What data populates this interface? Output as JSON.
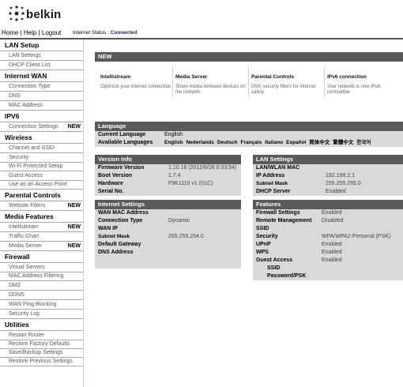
{
  "header": {
    "brand": "belkin",
    "nav": {
      "home": "Home",
      "sep1": "|",
      "help": "Help",
      "sep2": "|",
      "logout": "Logout"
    },
    "internet_status_label": "Internet Status :",
    "internet_status_value": "Connected"
  },
  "sidebar": {
    "sections": [
      {
        "title": "LAN Setup",
        "items": [
          {
            "label": "LAN Settings"
          },
          {
            "label": "DHCP Client List"
          }
        ]
      },
      {
        "title": "Internet WAN",
        "items": [
          {
            "label": "Connection Type"
          },
          {
            "label": "DNS"
          },
          {
            "label": "MAC Address"
          }
        ]
      },
      {
        "title": "IPV6",
        "items": [
          {
            "label": "Connection Settings",
            "badge": "NEW"
          }
        ]
      },
      {
        "title": "Wireless",
        "items": [
          {
            "label": "Channel and SSID"
          },
          {
            "label": "Security"
          },
          {
            "label": "Wi-Fi Protected Setup"
          },
          {
            "label": "Guest Access"
          },
          {
            "label": "Use as an Access Point"
          }
        ]
      },
      {
        "title": "Parental Controls",
        "items": [
          {
            "label": "Website Filters",
            "badge": "NEW"
          }
        ]
      },
      {
        "title": "Media Features",
        "items": [
          {
            "label": "Intellistream",
            "badge": "NEW"
          },
          {
            "label": "Traffic Chart"
          },
          {
            "label": "Media Server",
            "badge": "NEW"
          }
        ]
      },
      {
        "title": "Firewall",
        "items": [
          {
            "label": "Virtual Servers"
          },
          {
            "label": "MAC Address Filtering"
          },
          {
            "label": "DMZ"
          },
          {
            "label": "DDNS"
          },
          {
            "label": "WAN Ping Blocking"
          },
          {
            "label": "Security Log"
          }
        ]
      },
      {
        "title": "Utilities",
        "items": [
          {
            "label": "Restart Router"
          },
          {
            "label": "Restore Factory Defaults"
          },
          {
            "label": "Save/Backup Settings"
          },
          {
            "label": "Restore Previous Settings"
          }
        ]
      }
    ]
  },
  "new_section": {
    "title": "NEW",
    "features": [
      {
        "title": "Intellistream",
        "desc": "Optimize your internet connection"
      },
      {
        "title": "Media Server",
        "desc": "Share media between devices on the network."
      },
      {
        "title": "Parental Controls",
        "desc": "DNS security filters for internet safety"
      },
      {
        "title": "IPv6 connection",
        "desc": "Your network is now IPv6-compatible"
      }
    ]
  },
  "language": {
    "title": "Language",
    "current_label": "Current Language",
    "current_value": "English",
    "available_label": "Available Languages",
    "available": [
      "English",
      "Nederlands",
      "Deutsch",
      "Français",
      "Italiano",
      "Español",
      "简体中文",
      "繁體中文",
      "한국어"
    ]
  },
  "version_info": {
    "title": "Version Info",
    "rows": [
      {
        "k": "Firmware Version",
        "v": "1.10.16 (2012/6/28 0:33:54)"
      },
      {
        "k": "Boot Version",
        "v": "1.7.4"
      },
      {
        "k": "Hardware",
        "v": "F9K1110 v1 (01C)"
      },
      {
        "k": "Serial No.",
        "v": ""
      }
    ]
  },
  "lan_settings": {
    "title": "LAN Settings",
    "rows": [
      {
        "k": "LAN/WLAN MAC",
        "v": ""
      },
      {
        "k": "IP Address",
        "v": "192.168.2.1"
      },
      {
        "k": "Subnet Mask",
        "v": "255.255.255.0"
      },
      {
        "k": "DHCP Server",
        "v": "Enabled"
      }
    ]
  },
  "internet_settings": {
    "title": "Internet Settings",
    "rows": [
      {
        "k": "WAN MAC Address",
        "v": ""
      },
      {
        "k": "Connection Type",
        "v": "Dynamic"
      },
      {
        "k": "WAN IP",
        "v": ""
      },
      {
        "k": "Subnet Mask",
        "v": "255.255.254.0"
      },
      {
        "k": "Default Gateway",
        "v": ""
      },
      {
        "k": "DNS Address",
        "v": ""
      }
    ]
  },
  "features": {
    "title": "Features",
    "rows": [
      {
        "k": "Firewall Settings",
        "v": "Enabled"
      },
      {
        "k": "Remote Management",
        "v": "Disabled"
      },
      {
        "k": "SSID",
        "v": ""
      },
      {
        "k": "Security",
        "v": "WPA/WPA2-Personal (PSK)"
      },
      {
        "k": "UPnP",
        "v": "Enabled"
      },
      {
        "k": "WPS",
        "v": "Enabled"
      },
      {
        "k": "Guest Access",
        "v": "Enabled"
      },
      {
        "k": "SSID",
        "v": ""
      },
      {
        "k": "Password/PSK",
        "v": ""
      }
    ]
  }
}
